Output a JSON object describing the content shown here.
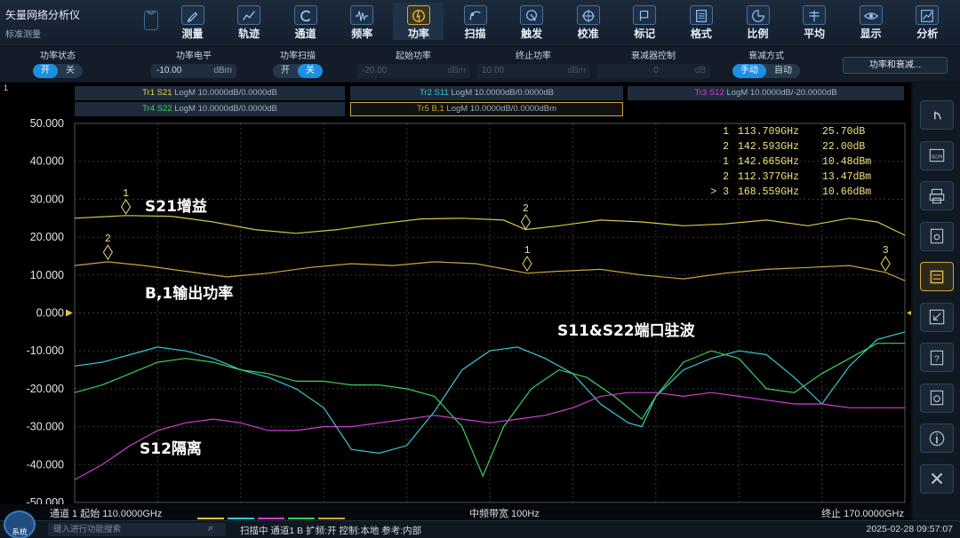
{
  "app": {
    "title": "矢量网络分析仪",
    "subtitle": "标准测量"
  },
  "toolbar": [
    {
      "label": "测量",
      "icon": "pencil-icon"
    },
    {
      "label": "轨迹",
      "icon": "trace-icon"
    },
    {
      "label": "通道",
      "icon": "channel-icon"
    },
    {
      "label": "频率",
      "icon": "waveform-icon"
    },
    {
      "label": "功率",
      "icon": "power-icon",
      "active": true
    },
    {
      "label": "扫描",
      "icon": "sweep-icon"
    },
    {
      "label": "触发",
      "icon": "trigger-icon"
    },
    {
      "label": "校准",
      "icon": "crosshair-icon"
    },
    {
      "label": "标记",
      "icon": "marker-icon"
    },
    {
      "label": "格式",
      "icon": "format-icon"
    },
    {
      "label": "比例",
      "icon": "scale-icon"
    },
    {
      "label": "平均",
      "icon": "average-icon"
    },
    {
      "label": "显示",
      "icon": "eye-icon"
    },
    {
      "label": "分析",
      "icon": "analysis-icon"
    }
  ],
  "params": {
    "power_state": {
      "label": "功率状态",
      "on": "开",
      "off": "关"
    },
    "power_level": {
      "label": "功率电平",
      "value": "-10.00",
      "unit": "dBm"
    },
    "power_sweep": {
      "label": "功率扫描",
      "on": "开",
      "off": "关"
    },
    "start_power": {
      "label": "起始功率",
      "value": "-20.00",
      "unit": "dBm"
    },
    "stop_power": {
      "label": "终止功率",
      "value": "10.00",
      "unit": "dBm"
    },
    "attenuator": {
      "label": "衰减器控制",
      "value": "0",
      "unit": "dB"
    },
    "atten_mode": {
      "label": "衰减方式",
      "manual": "手动",
      "auto": "自动"
    },
    "power_atten_button": "功率和衰减..."
  },
  "channel_number": "1",
  "traces": [
    {
      "id": "Tr1 S21",
      "desc": "LogM 10.0000dB/0.0000dB",
      "color": "#e8d64a"
    },
    {
      "id": "Tr2 S11",
      "desc": "LogM 10.0000dB/0.0000dB",
      "color": "#35c8d8"
    },
    {
      "id": "Tr3 S12",
      "desc": "LogM 10.0000dB/-20.0000dB",
      "color": "#d040d0"
    },
    {
      "id": "Tr4 S22",
      "desc": "LogM 10.0000dB/0.0000dB",
      "color": "#3ecf5a"
    },
    {
      "id": "Tr5 B,1",
      "desc": "LogM 10.0000dB/0.0000dBm",
      "color": "#caa642"
    }
  ],
  "markers_table": [
    {
      "n": "1",
      "freq": "113.709GHz",
      "val": "25.70dB"
    },
    {
      "n": "2",
      "freq": "142.593GHz",
      "val": "22.00dB"
    },
    {
      "n": "1",
      "freq": "142.665GHz",
      "val": "10.48dBm"
    },
    {
      "n": "2",
      "freq": "112.377GHz",
      "val": "13.47dBm"
    },
    {
      "n": "> 3",
      "freq": "168.559GHz",
      "val": "10.66dBm"
    }
  ],
  "annotations": {
    "s21": "S21增益",
    "b1": "B,1输出功率",
    "s11s22": "S11&S22端口驻波",
    "s12": "S12隔离"
  },
  "bottom": {
    "start": "通道 1 起始 110.0000GHz",
    "ifbw": "中频带宽 100Hz",
    "stop": "终止 170.0000GHz"
  },
  "status": {
    "system": "系统",
    "search_placeholder": "键入进行功能搜索",
    "text": "扫描中  通道1 B 扩频:开 控制:本地 参考:内部",
    "clock": "2025-02-28 09:57:07"
  },
  "sidebar_icons": [
    "hand-touch-icon",
    "scpi-icon",
    "print-icon",
    "save-icon",
    "trace-select-icon",
    "minimize-icon",
    "help-doc-icon",
    "settings-doc-icon",
    "info-icon",
    "close-x-icon"
  ],
  "chart_data": {
    "type": "line",
    "x_unit": "GHz",
    "xlim": [
      110,
      170
    ],
    "ylim": [
      -50,
      50
    ],
    "y_ticks": [
      "50.000",
      "40.000",
      "30.000",
      "20.000",
      "10.000",
      "0.000",
      "-10.000",
      "-20.000",
      "-30.000",
      "-40.000",
      "-50.000"
    ],
    "grid": true,
    "series": [
      {
        "name": "Tr1 S21",
        "color": "#d8c84a",
        "x": [
          110,
          113.7,
          117,
          120,
          123,
          126,
          129,
          132,
          135,
          138,
          141,
          142.6,
          145,
          148,
          151,
          154,
          157,
          160,
          163,
          166,
          168,
          170
        ],
        "y": [
          25.0,
          25.7,
          25.5,
          24.0,
          22.0,
          21.0,
          22.0,
          23.5,
          24.8,
          25.0,
          24.5,
          22.0,
          23.0,
          24.5,
          24.0,
          23.0,
          23.5,
          24.5,
          23.0,
          25.0,
          24.0,
          20.5
        ]
      },
      {
        "name": "Tr5 B,1",
        "color": "#caa642",
        "x": [
          110,
          112.4,
          115,
          118,
          121,
          124,
          127,
          130,
          133,
          136,
          139,
          142.7,
          145,
          148,
          151,
          154,
          157,
          160,
          163,
          166,
          168.6,
          170
        ],
        "y": [
          12.5,
          13.5,
          12.5,
          11.0,
          9.5,
          10.5,
          12.0,
          13.0,
          12.5,
          13.5,
          13.0,
          10.5,
          11.0,
          11.5,
          10.0,
          9.0,
          10.5,
          11.5,
          12.0,
          12.5,
          10.7,
          8.5
        ]
      },
      {
        "name": "Tr2 S11",
        "color": "#35c8d8",
        "x": [
          110,
          112,
          114,
          116,
          118,
          120,
          122,
          124,
          126,
          128,
          130,
          132,
          134,
          136,
          138,
          140,
          142,
          144,
          146,
          148,
          150,
          151,
          152,
          154,
          156,
          158,
          160,
          162,
          164,
          166,
          168,
          170
        ],
        "y": [
          -14,
          -13,
          -11,
          -9,
          -10,
          -12,
          -15,
          -17,
          -20,
          -25,
          -36,
          -37,
          -35,
          -26,
          -15,
          -10,
          -9,
          -12,
          -16,
          -24,
          -29,
          -30,
          -22,
          -15,
          -12,
          -10,
          -11,
          -17,
          -24,
          -14,
          -7,
          -5
        ]
      },
      {
        "name": "Tr4 S22",
        "color": "#3ecf5a",
        "x": [
          110,
          112,
          114,
          116,
          118,
          120,
          122,
          124,
          126,
          128,
          130,
          132,
          134,
          136,
          138,
          139.5,
          141,
          143,
          145,
          147,
          149,
          151,
          152,
          154,
          156,
          158,
          160,
          162,
          164,
          166,
          168,
          170
        ],
        "y": [
          -21,
          -19,
          -16,
          -13,
          -12,
          -13,
          -15,
          -16,
          -18,
          -18,
          -19,
          -19,
          -20,
          -22,
          -30,
          -43,
          -30,
          -20,
          -15,
          -17,
          -22,
          -28,
          -22,
          -13,
          -10,
          -12,
          -20,
          -21,
          -16,
          -12,
          -8,
          -8
        ]
      },
      {
        "name": "Tr3 S12",
        "color": "#d040d0",
        "x": [
          110,
          112,
          114,
          116,
          118,
          120,
          122,
          124,
          126,
          128,
          130,
          132,
          134,
          136,
          138,
          140,
          142,
          144,
          146,
          148,
          150,
          152,
          154,
          156,
          158,
          160,
          162,
          164,
          166,
          168,
          170
        ],
        "y": [
          -44,
          -40,
          -35,
          -31,
          -29,
          -28,
          -29,
          -31,
          -31,
          -30,
          -30,
          -29,
          -28,
          -27,
          -28,
          -29,
          -28,
          -27,
          -25,
          -22,
          -21,
          -21,
          -22,
          -21,
          -22,
          -23,
          -24,
          -24,
          -25,
          -25,
          -25
        ]
      }
    ],
    "markers": [
      {
        "label": "1",
        "series": "Tr1 S21",
        "x": 113.7,
        "y": 28.0
      },
      {
        "label": "2",
        "series": "Tr1 S21",
        "x": 142.6,
        "y": 24.0
      },
      {
        "label": "2",
        "series": "Tr5 B,1",
        "x": 112.4,
        "y": 16.0
      },
      {
        "label": "1",
        "series": "Tr5 B,1",
        "x": 142.7,
        "y": 13.0
      },
      {
        "label": "3",
        "series": "Tr5 B,1",
        "x": 168.6,
        "y": 13.0
      }
    ]
  }
}
